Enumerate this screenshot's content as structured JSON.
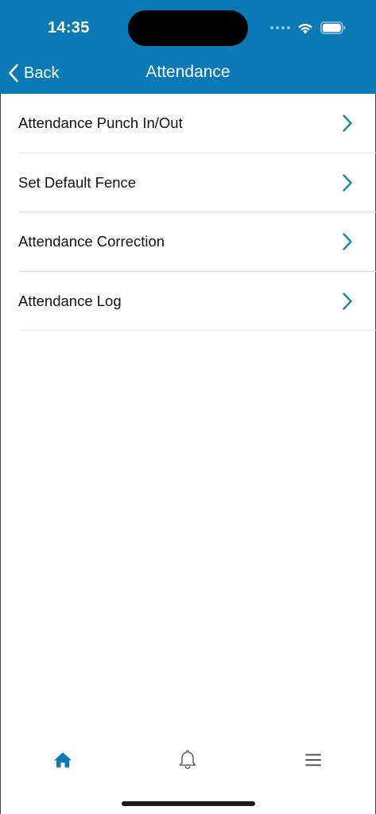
{
  "status_bar": {
    "time": "14:35"
  },
  "nav": {
    "back_label": "Back",
    "title": "Attendance"
  },
  "menu": {
    "items": [
      {
        "label": "Attendance Punch In/Out"
      },
      {
        "label": "Set Default Fence"
      },
      {
        "label": "Attendance Correction"
      },
      {
        "label": "Attendance Log"
      }
    ]
  },
  "tab_bar": {
    "items": [
      {
        "icon": "home-icon",
        "active": true
      },
      {
        "icon": "bell-icon",
        "active": false
      },
      {
        "icon": "hamburger-menu-icon",
        "active": false
      }
    ]
  },
  "colors": {
    "header_bg": "#0a79b6",
    "chevron": "#1a8a9a",
    "active_tab": "#0a79b6",
    "inactive_tab": "#555555"
  }
}
